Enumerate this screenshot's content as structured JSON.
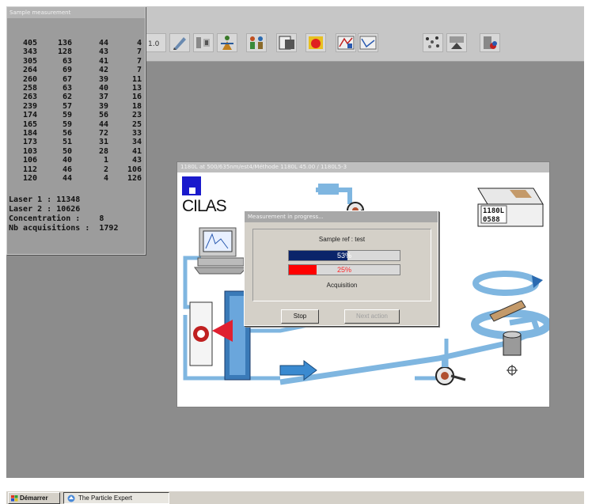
{
  "sample_panel": {
    "title": "Sample measurement",
    "rows": [
      [
        "405",
        "136",
        "44",
        "4"
      ],
      [
        "343",
        "128",
        "43",
        "7"
      ],
      [
        "305",
        "63",
        "41",
        "7"
      ],
      [
        "264",
        "69",
        "42",
        "7"
      ],
      [
        "260",
        "67",
        "39",
        "11"
      ],
      [
        "258",
        "63",
        "40",
        "13"
      ],
      [
        "263",
        "62",
        "37",
        "16"
      ],
      [
        "239",
        "57",
        "39",
        "18"
      ],
      [
        "174",
        "59",
        "56",
        "23"
      ],
      [
        "165",
        "59",
        "44",
        "25"
      ],
      [
        "184",
        "56",
        "72",
        "33"
      ],
      [
        "173",
        "51",
        "31",
        "34"
      ],
      [
        "103",
        "50",
        "28",
        "41"
      ],
      [
        "106",
        "40",
        "1",
        "43"
      ],
      [
        "112",
        "46",
        "2",
        "106"
      ],
      [
        "120",
        "44",
        "4",
        "126"
      ]
    ],
    "laser1": "Laser 1 : 11348",
    "laser2": "Laser 2 : 10626",
    "concentration": "Concentration :    8",
    "acquisitions": "Nb acquisitions :  1792"
  },
  "app_window": {
    "title": "1180L at 500/635nm/est4/Méthode 1180L 45.00 / 1180L5-3",
    "logo_text": "CILAS",
    "device_label_1": "1180L",
    "device_label_2": "0588"
  },
  "dialog": {
    "title": "Measurement in progress...",
    "sample_ref": "Sample ref : test",
    "progress1_text": "53%",
    "progress1_value": 0.53,
    "progress2_text": "25%",
    "progress2_value": 0.25,
    "status": "Acquisition",
    "stop_label": "Stop",
    "next_label": "Next action"
  },
  "taskbar": {
    "start_label": "Démarrer",
    "task_label": "The Particle Expert"
  },
  "colors": {
    "desktop": "#8c8c8c",
    "progress_blue": "#0a246a",
    "progress_red": "#ff0000",
    "pipe_blue": "#7fb6e0"
  },
  "toolbar_icons": [
    "scale-icon",
    "pen-icon",
    "tools-icon",
    "figure-icon",
    "people-icon",
    "document-icon",
    "color-square-icon",
    "chart-icon",
    "scatter-icon",
    "printer-icon"
  ]
}
